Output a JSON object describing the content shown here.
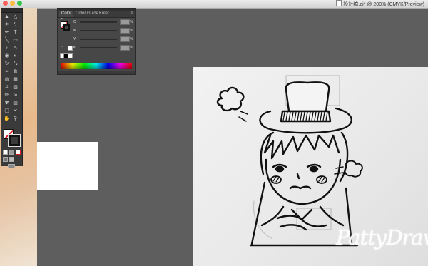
{
  "window": {
    "document_title": "設計稿.ai* @ 200% (CMYK/Preview)"
  },
  "traffic_lights": {
    "close": "#fc605c",
    "minimize": "#fdbc40",
    "zoom": "#34c84a"
  },
  "color_panel": {
    "tabs": [
      {
        "label": "Color",
        "active": true
      },
      {
        "label": "Color Guide",
        "active": false
      },
      {
        "label": "Kuler",
        "active": false
      }
    ],
    "menu_glyph": "≡",
    "sliders": [
      {
        "label": "C",
        "unit": "%"
      },
      {
        "label": "M",
        "unit": "%"
      },
      {
        "label": "Y",
        "unit": "%"
      },
      {
        "label": "K",
        "unit": "%"
      }
    ]
  },
  "tools": [
    "selection-tool",
    "direct-selection-tool",
    "magic-wand-tool",
    "lasso-tool",
    "pen-tool",
    "type-tool",
    "line-tool",
    "rectangle-tool",
    "paintbrush-tool",
    "pencil-tool",
    "blob-brush-tool",
    "eraser-tool",
    "rotate-tool",
    "scale-tool",
    "width-tool",
    "free-transform-tool",
    "shape-builder-tool",
    "perspective-grid-tool",
    "mesh-tool",
    "gradient-tool",
    "eyedropper-tool",
    "blend-tool",
    "symbol-sprayer-tool",
    "column-graph-tool",
    "artboard-tool",
    "slice-tool",
    "hand-tool",
    "zoom-tool"
  ],
  "watermark": "PattyDraw",
  "colors": {
    "canvas_bg": "#5e5e5e",
    "panel_bg": "#474747",
    "accent_none": "#e0191e"
  }
}
